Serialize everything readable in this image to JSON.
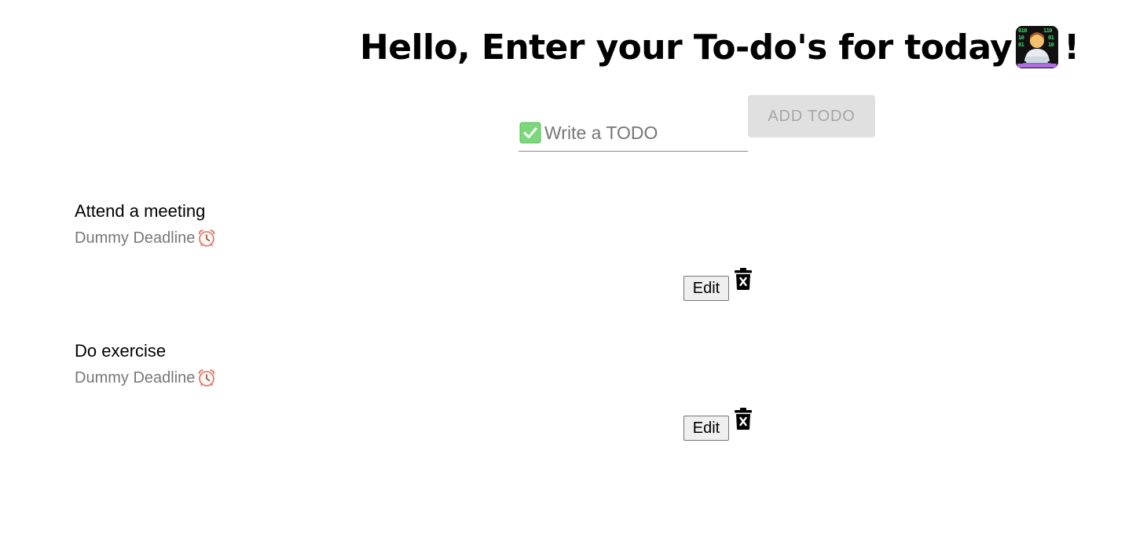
{
  "header": {
    "title": "Hello, Enter your To-do's for today",
    "title_suffix": "!",
    "emoji_icon": "technologist-emoji-icon"
  },
  "new_todo": {
    "input_placeholder": "Write a TODO",
    "input_value": "",
    "input_icon": "check-mark-icon",
    "add_button_label": "ADD TODO",
    "add_button_enabled": false
  },
  "todos": [
    {
      "title": "Attend a meeting",
      "deadline": "Dummy Deadline",
      "deadline_icon": "alarm-clock-icon",
      "edit_label": "Edit",
      "delete_icon": "trash-icon"
    },
    {
      "title": "Do exercise",
      "deadline": "Dummy Deadline",
      "deadline_icon": "alarm-clock-icon",
      "edit_label": "Edit",
      "delete_icon": "trash-icon"
    }
  ],
  "colors": {
    "add_button_bg": "#e0e0e0",
    "add_button_text": "#a6a6a6",
    "deadline_text": "#777777",
    "check_green": "#7bd87b"
  }
}
